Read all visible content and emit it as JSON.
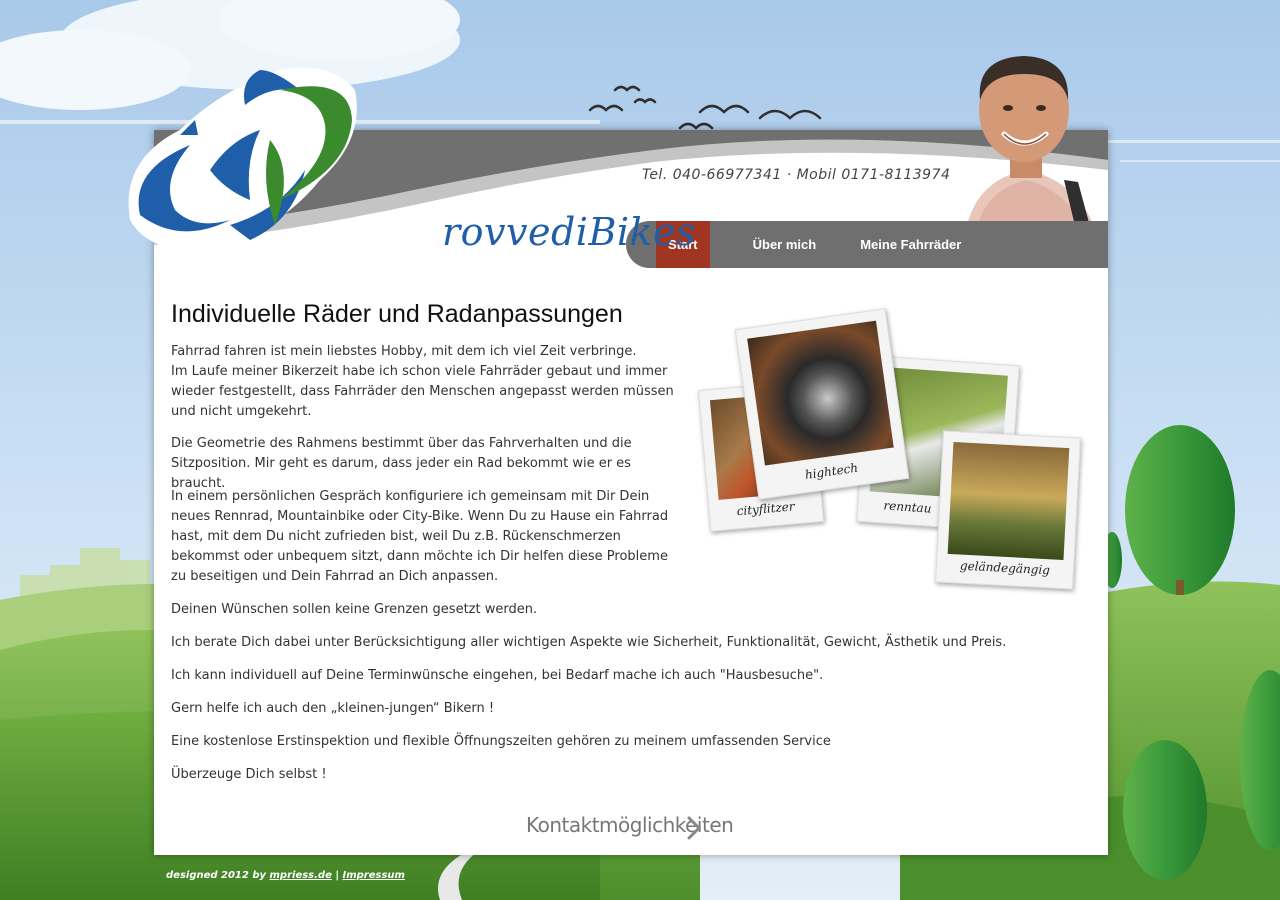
{
  "brand": {
    "logo_text": "rovvediBikes"
  },
  "header": {
    "phone": "Tel. 040-66977341 · Mobil 0171-8113974"
  },
  "nav": {
    "items": [
      {
        "label": "Start"
      },
      {
        "label": "Über mich"
      },
      {
        "label": "Meine Fahrräder"
      }
    ]
  },
  "main": {
    "title": "Individuelle Räder und Radanpassungen",
    "paragraphs": [
      "Fahrrad fahren ist mein liebstes Hobby, mit dem ich viel Zeit verbringe.",
      "Im Laufe meiner Bikerzeit habe ich schon viele Fahrräder gebaut und immer wieder festgestellt, dass Fahrräder den Menschen angepasst werden müssen und nicht umgekehrt.",
      "Die Geometrie des Rahmens bestimmt über das Fahrverhalten und die Sitzposition. Mir geht es darum, dass jeder ein Rad bekommt wie er es braucht.",
      "In einem persönlichen Gespräch konfiguriere ich gemeinsam mit Dir Dein neues Rennrad, Mountainbike oder City-Bike. Wenn Du zu Hause ein Fahrrad hast, mit dem Du nicht zufrieden bist, weil Du z.B. Rückenschmerzen bekommst oder unbequem sitzt, dann möchte ich Dir helfen diese Probleme zu beseitigen und Dein Fahrrad an Dich anpassen.",
      "Deinen Wünschen sollen keine Grenzen gesetzt werden.",
      "Ich berate Dich dabei unter Berücksichtigung aller wichtigen Aspekte wie Sicherheit, Funktionalität, Gewicht, Ästhetik und Preis.",
      "Ich kann individuell auf Deine Terminwünsche eingehen, bei Bedarf mache ich auch \"Hausbesuche\".",
      "Gern helfe ich auch den „kleinen-jungen“ Bikern !",
      "Eine kostenlose Erstinspektion und flexible Öffnungszeiten gehören zu meinem umfassenden Service",
      "Überzeuge Dich selbst !"
    ],
    "contact_link": "Kontaktmöglichkeiten"
  },
  "gallery": {
    "captions": [
      "cityflitzer",
      "hightech",
      "renntau",
      "geländegängig"
    ]
  },
  "footer": {
    "prefix": "designed 2012 by",
    "designer_link": "mpriess.de",
    "separator": "|",
    "impressum_link": "Impressum"
  },
  "colors": {
    "accent": "#a03621",
    "nav_bg": "#6f6f6f",
    "logo_blue": "#1f5ea8",
    "logo_green": "#3c8a2e",
    "grass": "#5aa03a",
    "sky": "#b7d3ee"
  }
}
